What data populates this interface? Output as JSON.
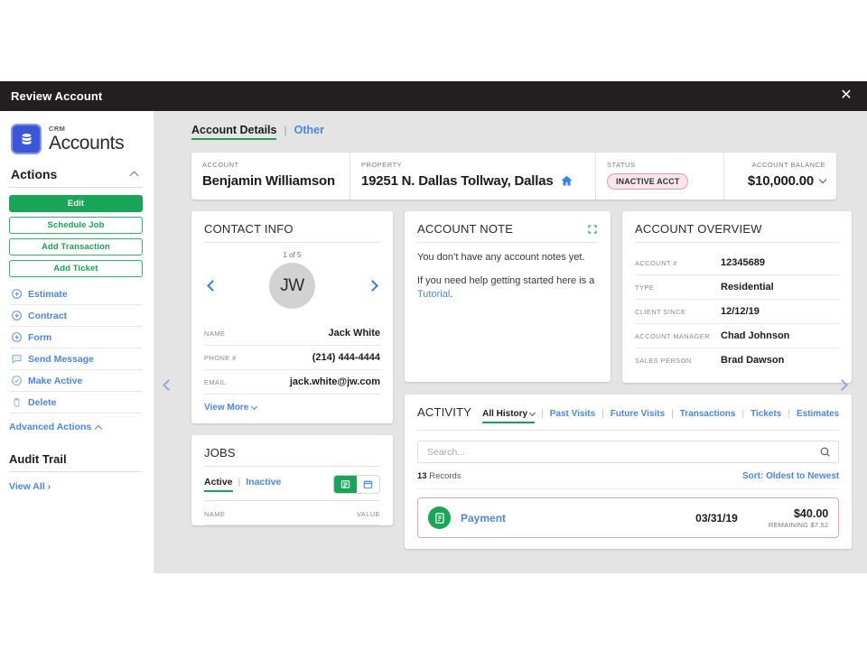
{
  "window": {
    "title": "Review Account",
    "close_label": "✕"
  },
  "sidebar": {
    "logo": {
      "kicker": "CRM",
      "title": "Accounts"
    },
    "actions_header": "Actions",
    "buttons": [
      {
        "label": "Edit",
        "style": "primary"
      },
      {
        "label": "Schedule Job",
        "style": "outline"
      },
      {
        "label": "Add Transaction",
        "style": "outline"
      },
      {
        "label": "Add Ticket",
        "style": "outline"
      }
    ],
    "action_items": [
      {
        "label": "Estimate",
        "icon": "plus-circle-icon"
      },
      {
        "label": "Contract",
        "icon": "plus-circle-icon"
      },
      {
        "label": "Form",
        "icon": "plus-circle-icon"
      },
      {
        "label": "Send Message",
        "icon": "chat-bubble-icon"
      },
      {
        "label": "Make Active",
        "icon": "check-circle-icon"
      },
      {
        "label": "Delete",
        "icon": "trash-icon"
      }
    ],
    "advanced_actions": "Advanced Actions",
    "audit_trail_header": "Audit Trail",
    "view_all": "View All  ›"
  },
  "tabs": {
    "account_details": "Account Details",
    "separator": "|",
    "other": "Other"
  },
  "header_strip": {
    "account": {
      "label": "ACCOUNT",
      "value": "Benjamin Williamson"
    },
    "property": {
      "label": "PROPERTY",
      "value": "19251 N. Dallas Tollway, Dallas",
      "icon": "home-icon"
    },
    "status": {
      "label": "STATUS",
      "value": "INACTIVE ACCT"
    },
    "balance": {
      "label": "ACCOUNT BALANCE",
      "value": "$10,000.00"
    }
  },
  "contact_info": {
    "title": "CONTACT INFO",
    "pager": "1 of 5",
    "avatar_initials": "JW",
    "rows": [
      {
        "key": "NAME",
        "value": "Jack White"
      },
      {
        "key": "PHONE #",
        "value": "(214) 444-4444"
      },
      {
        "key": "EMAIL",
        "value": "jack.white@jw.com"
      }
    ],
    "view_more": "View More"
  },
  "account_note": {
    "title": "ACCOUNT NOTE",
    "paragraph1": "You don’t have any account notes yet.",
    "paragraph2_pre": "If you need help getting started here is a ",
    "paragraph2_link": "Tutorial",
    "paragraph2_post": "."
  },
  "account_overview": {
    "title": "ACCOUNT OVERVIEW",
    "rows": [
      {
        "key": "ACCOUNT #",
        "value": "12345689"
      },
      {
        "key": "TYPE",
        "value": "Residential"
      },
      {
        "key": "CLIENT SINCE",
        "value": "12/12/19"
      },
      {
        "key": "ACCOUNT MANAGER",
        "value": "Chad Johnson"
      },
      {
        "key": "SALES PERSON",
        "value": "Brad Dawson"
      }
    ]
  },
  "jobs": {
    "title": "JOBS",
    "tab_active": "Active",
    "tab_sep": "|",
    "tab_inactive": "Inactive",
    "view_list_icon": "list-view-icon",
    "view_calendar_icon": "calendar-view-icon",
    "col_name": "NAME",
    "col_value": "VALUE"
  },
  "activity": {
    "title": "ACTIVITY",
    "filter_active": "All History",
    "filters": [
      "Past Visits",
      "Future Visits",
      "Transactions",
      "Tickets",
      "Estimates"
    ],
    "search_placeholder": "Search...",
    "search_value": "",
    "records_count": "13",
    "records_label": " Records",
    "sort_label": "Sort: Oldest to Newest",
    "rows": [
      {
        "icon": "payment-icon",
        "name": "Payment",
        "date": "03/31/19",
        "amount": "$40.00",
        "remaining": "REMAINING $7.52"
      }
    ]
  },
  "colors": {
    "accent_green": "#18a558",
    "link_blue": "#4a86e8",
    "status_border": "#e79aa8",
    "status_bg": "#fbe7ea",
    "logo_blue": "#3b57d8"
  }
}
